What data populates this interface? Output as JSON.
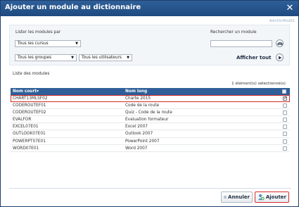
{
  "dialog": {
    "title": "Ajouter un module au dictionnaire",
    "id_label": "AdmDicMod01",
    "close_icon": "close-icon"
  },
  "filters": {
    "list_label": "Lister les modules par",
    "cursus_value": "Tous les cursus",
    "groups_value": "Tous les groupes",
    "users_value": "Tous les utilisateurs",
    "search_label": "Rechercher un module",
    "search_value": "",
    "show_all_label": "Afficher tout",
    "search_icon": "binoculars-icon",
    "play_icon": "play-icon"
  },
  "table": {
    "section_label": "Liste des modules",
    "selected_count": "1 élément(s) sélectionné(s)",
    "columns": [
      "Nom court",
      "Nom long"
    ],
    "sort_indicator": "▾",
    "rows": [
      {
        "short": "CHART13MLSF02",
        "long": "Charte 2015",
        "checked": true
      },
      {
        "short": "CODEROUTEF01",
        "long": "Code de la route",
        "checked": false
      },
      {
        "short": "CODEROUTEF02",
        "long": "Quiz - Code de la route",
        "checked": false
      },
      {
        "short": "EVALFOR",
        "long": "Evaluation formateur",
        "checked": false
      },
      {
        "short": "EXCEL07E01",
        "long": "Excel 2007",
        "checked": false
      },
      {
        "short": "OUTLOOK07E01",
        "long": "Outlook 2007",
        "checked": false
      },
      {
        "short": "POWERPT07E01",
        "long": "PowerPoint 2007",
        "checked": false
      },
      {
        "short": "WORD07E01",
        "long": "Word 2007",
        "checked": false
      }
    ]
  },
  "footer": {
    "cancel_label": "Annuler",
    "add_label": "Ajouter"
  },
  "colors": {
    "header_blue": "#2f5f98",
    "selection_red": "#d42a2a"
  }
}
